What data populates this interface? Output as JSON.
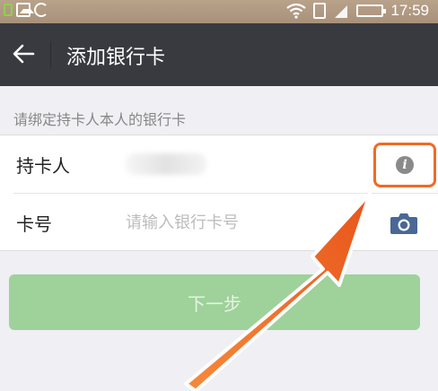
{
  "status_bar": {
    "time": "17:59",
    "icons": [
      "app-notification-icon",
      "gallery-icon",
      "sync-icon",
      "wifi-icon",
      "phone-icon",
      "signal-icon",
      "battery-icon"
    ]
  },
  "header": {
    "back_icon": "back-arrow-icon",
    "title": "添加银行卡"
  },
  "form": {
    "hint": "请绑定持卡人本人的银行卡",
    "holder": {
      "label": "持卡人",
      "info_icon": "info-icon"
    },
    "card_number": {
      "label": "卡号",
      "placeholder": "请输入银行卡号",
      "camera_icon": "camera-icon"
    }
  },
  "actions": {
    "next_label": "下一步"
  },
  "colors": {
    "status_bar": "#b9a28a",
    "header_bg": "#393a3f",
    "page_bg": "#efeff4",
    "next_button": "#9ed29a",
    "annotation": "#f06a24"
  }
}
